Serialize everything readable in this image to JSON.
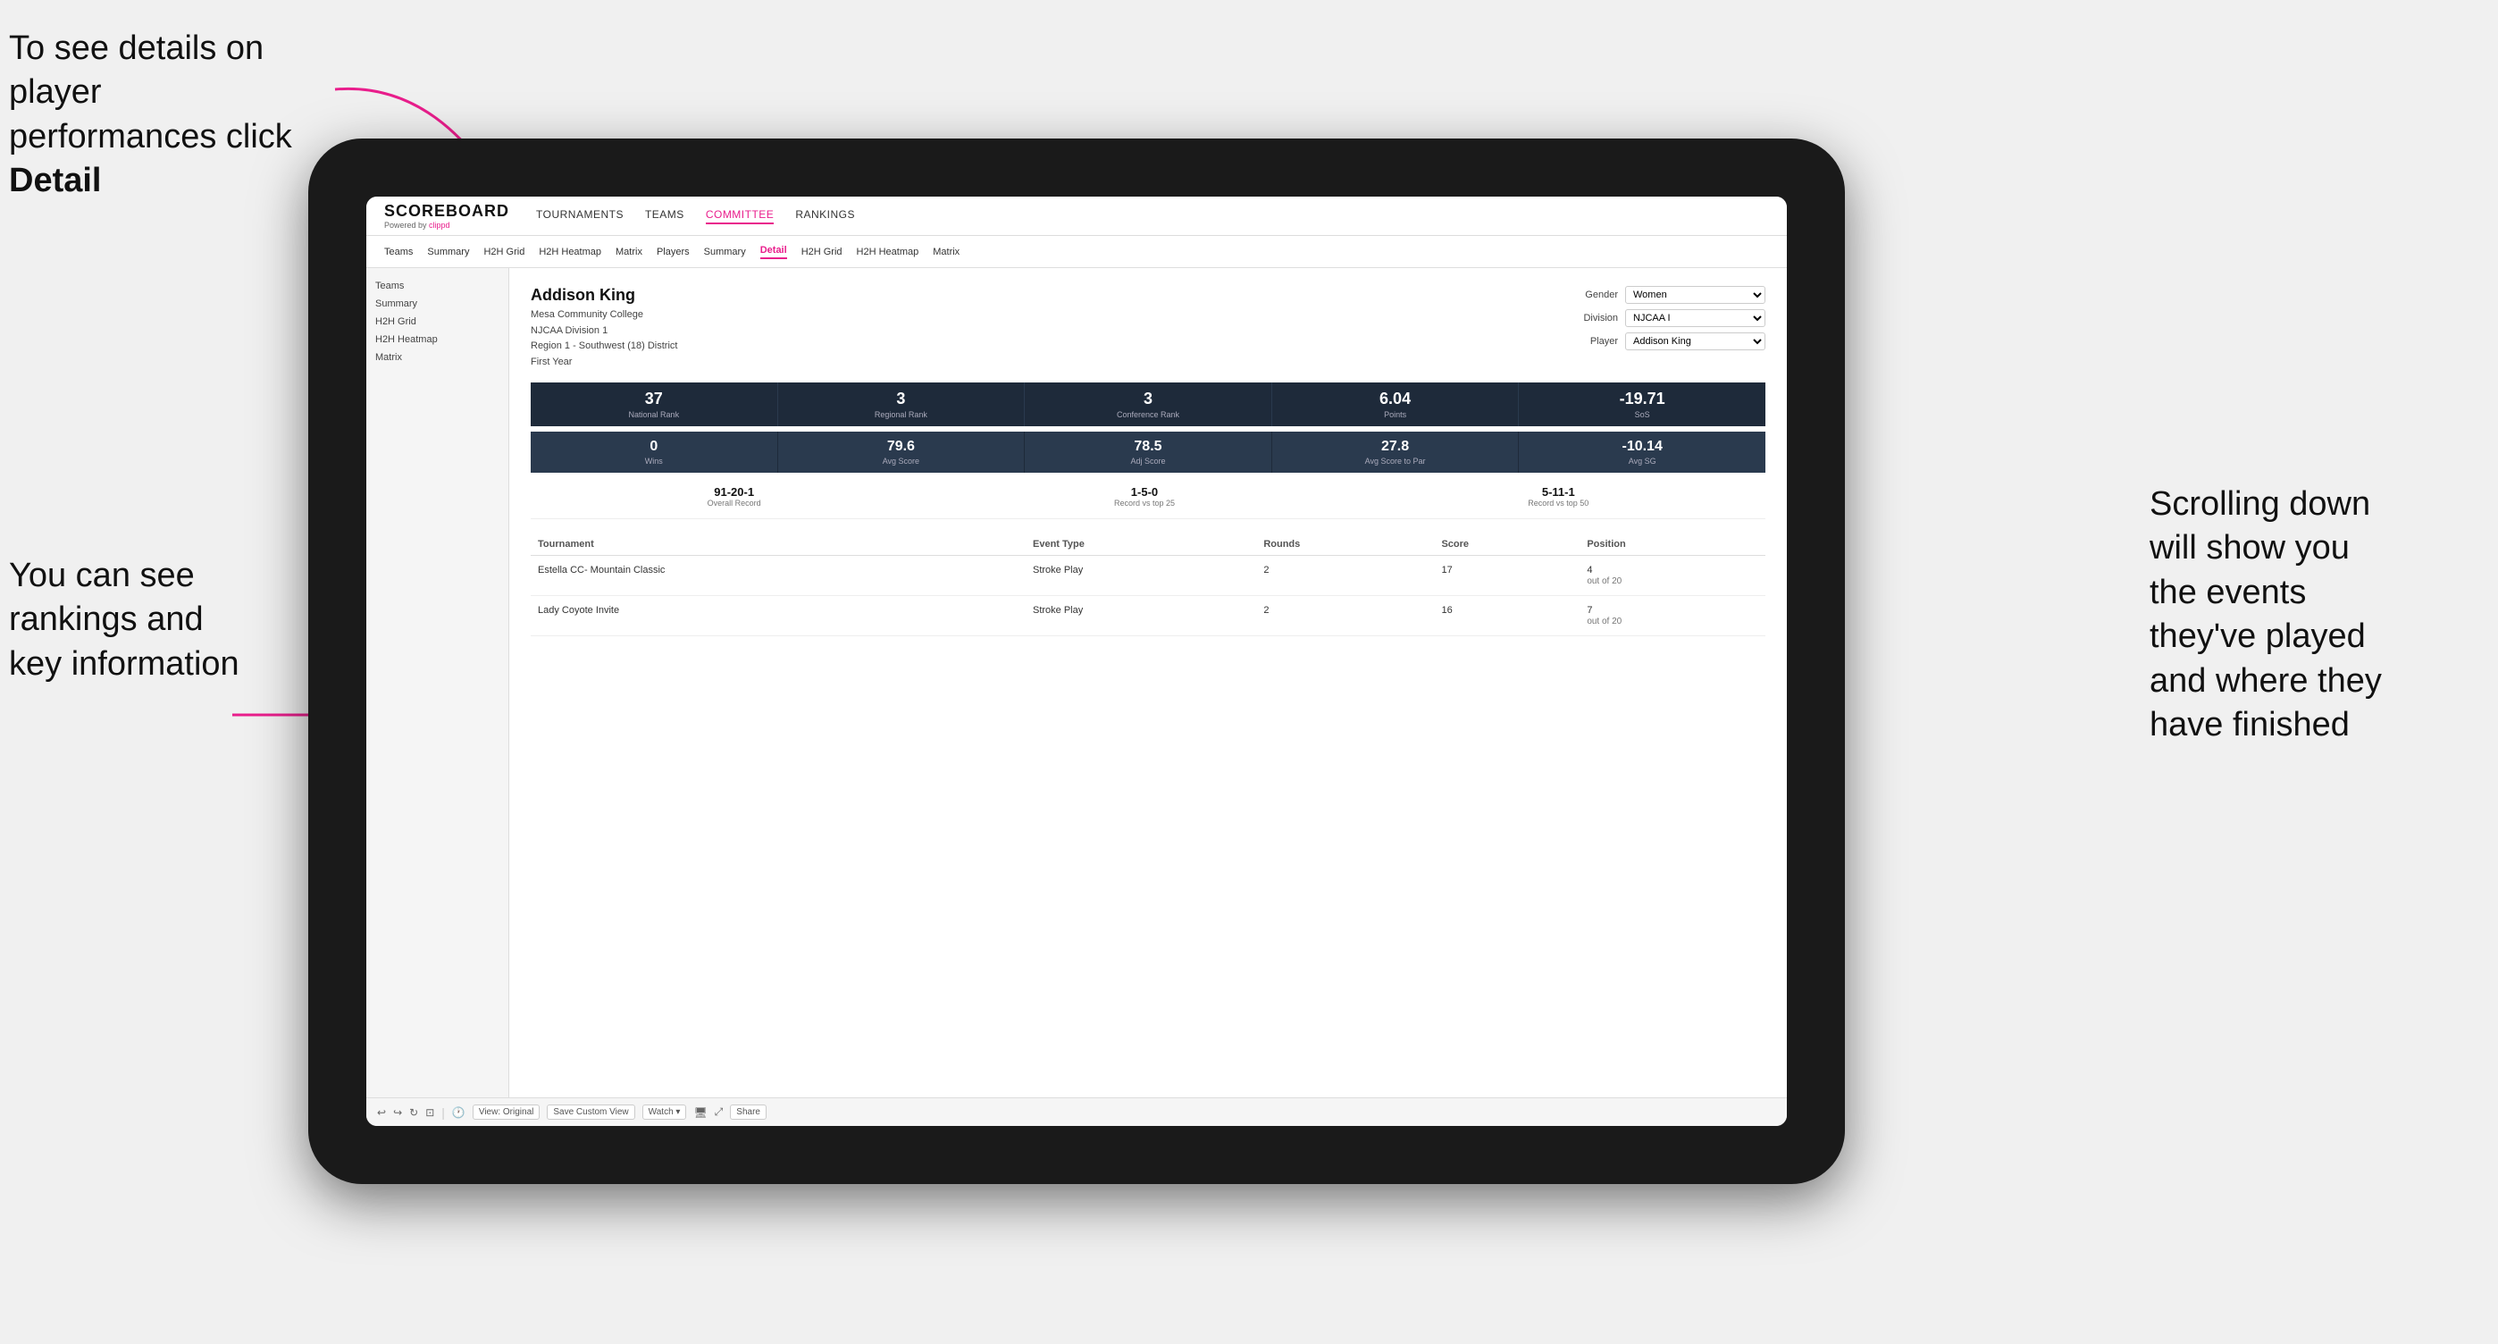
{
  "annotations": {
    "top_left": "To see details on player performances click ",
    "top_left_bold": "Detail",
    "bottom_left_line1": "You can see",
    "bottom_left_line2": "rankings and",
    "bottom_left_line3": "key information",
    "right_line1": "Scrolling down",
    "right_line2": "will show you",
    "right_line3": "the events",
    "right_line4": "they've played",
    "right_line5": "and where they",
    "right_line6": "have finished"
  },
  "nav": {
    "logo": "SCOREBOARD",
    "logo_sub": "Powered by clippd",
    "items": [
      "TOURNAMENTS",
      "TEAMS",
      "COMMITTEE",
      "RANKINGS"
    ]
  },
  "sub_nav": {
    "items": [
      "Teams",
      "Summary",
      "H2H Grid",
      "H2H Heatmap",
      "Matrix",
      "Players",
      "Summary",
      "Detail",
      "H2H Grid",
      "H2H Heatmap",
      "Matrix"
    ]
  },
  "sidebar": {
    "links": [
      "Teams",
      "Summary",
      "H2H Grid",
      "H2H Heatmap",
      "Matrix"
    ]
  },
  "player": {
    "name": "Addison King",
    "college": "Mesa Community College",
    "division": "NJCAA Division 1",
    "region": "Region 1 - Southwest (18) District",
    "year": "First Year"
  },
  "controls": {
    "gender_label": "Gender",
    "gender_value": "Women",
    "division_label": "Division",
    "division_value": "NJCAA I",
    "player_label": "Player",
    "player_value": "Addison King"
  },
  "stats_row1": [
    {
      "value": "37",
      "label": "National Rank"
    },
    {
      "value": "3",
      "label": "Regional Rank"
    },
    {
      "value": "3",
      "label": "Conference Rank"
    },
    {
      "value": "6.04",
      "label": "Points"
    },
    {
      "value": "-19.71",
      "label": "SoS"
    }
  ],
  "stats_row2": [
    {
      "value": "0",
      "label": "Wins"
    },
    {
      "value": "79.6",
      "label": "Avg Score"
    },
    {
      "value": "78.5",
      "label": "Adj Score"
    },
    {
      "value": "27.8",
      "label": "Avg Score to Par"
    },
    {
      "value": "-10.14",
      "label": "Avg SG"
    }
  ],
  "records": [
    {
      "value": "91-20-1",
      "label": "Overall Record"
    },
    {
      "value": "1-5-0",
      "label": "Record vs top 25"
    },
    {
      "value": "5-11-1",
      "label": "Record vs top 50"
    }
  ],
  "table": {
    "headers": [
      "Tournament",
      "Event Type",
      "Rounds",
      "Score",
      "Position"
    ],
    "rows": [
      {
        "tournament": "Estella CC- Mountain Classic",
        "event_type": "Stroke Play",
        "rounds": "2",
        "score": "17",
        "position": "4\nout of 20"
      },
      {
        "tournament": "Lady Coyote Invite",
        "event_type": "Stroke Play",
        "rounds": "2",
        "score": "16",
        "position": "7\nout of 20"
      }
    ]
  },
  "toolbar": {
    "buttons": [
      "View: Original",
      "Save Custom View",
      "Watch ▾",
      "Share"
    ]
  }
}
